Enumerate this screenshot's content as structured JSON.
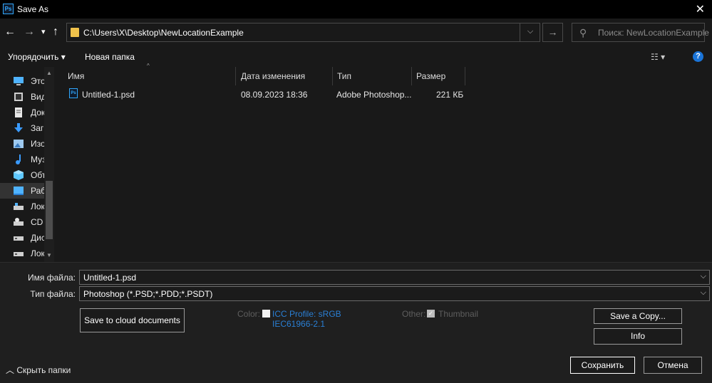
{
  "window": {
    "title": "Save As",
    "app_icon": "Ps",
    "close": "✕"
  },
  "nav": {
    "back": "←",
    "forward": "→",
    "recent": "▾",
    "up": "↑",
    "address": "C:\\Users\\X\\Desktop\\NewLocationExample",
    "address_dropdown": "⌵",
    "go": "→",
    "search_placeholder": "Поиск: NewLocationExample"
  },
  "toolbar": {
    "organize": "Упорядочить ▾",
    "new_folder": "Новая папка",
    "view": "☷ ▾",
    "help": "?"
  },
  "sidebar": {
    "items": [
      {
        "label": "Этот компьютер",
        "icon": "computer-icon",
        "color": "#4fb3ff"
      },
      {
        "label": "Видео",
        "icon": "video-icon",
        "color": "#cfcfcf"
      },
      {
        "label": "Документы",
        "icon": "document-icon",
        "color": "#cfcfcf"
      },
      {
        "label": "Загрузки",
        "icon": "download-icon",
        "color": "#3a9bff"
      },
      {
        "label": "Изображения",
        "icon": "pictures-icon",
        "color": "#9ec9ef"
      },
      {
        "label": "Музыка",
        "icon": "music-icon",
        "color": "#3a9bff"
      },
      {
        "label": "Объемные объекты",
        "icon": "3d-objects-icon",
        "color": "#5ec8ff"
      },
      {
        "label": "Рабочий стол",
        "icon": "desktop-icon",
        "color": "#4fb3ff"
      },
      {
        "label": "Локальный диск",
        "icon": "drive-icon",
        "color": "#cfcfcf"
      },
      {
        "label": "CD",
        "icon": "cd-drive-icon",
        "color": "#cfcfcf"
      },
      {
        "label": "Диск",
        "icon": "drive-icon",
        "color": "#cfcfcf"
      },
      {
        "label": "Локальный",
        "icon": "drive-icon",
        "color": "#cfcfcf"
      }
    ]
  },
  "columns": {
    "name": "Имя",
    "date": "Дата изменения",
    "type": "Тип",
    "size": "Размер"
  },
  "files": [
    {
      "name": "Untitled-1.psd",
      "date": "08.09.2023 18:36",
      "type": "Adobe Photoshop...",
      "size": "221 КБ"
    }
  ],
  "form": {
    "filename_label": "Имя файла:",
    "filename_value": "Untitled-1.psd",
    "filetype_label": "Тип файла:",
    "filetype_value": "Photoshop (*.PSD;*.PDD;*.PSDT)",
    "dropdown_arrow": "⌵"
  },
  "options": {
    "cloud_button": "Save to cloud documents",
    "color_label": "Color:",
    "icc_line1": "ICC Profile:  sRGB",
    "icc_line2": "IEC61966-2.1",
    "other_label": "Other:",
    "thumbnail": "Thumbnail",
    "save_copy": "Save a Copy...",
    "info": "Info"
  },
  "footer": {
    "hide_folders": "Скрыть папки",
    "save": "Сохранить",
    "cancel": "Отмена"
  }
}
